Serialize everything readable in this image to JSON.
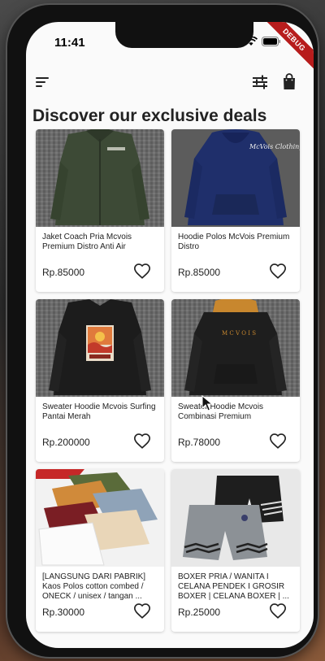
{
  "status_bar": {
    "time": "11:41"
  },
  "debug_banner": "DEBUG",
  "appbar": {
    "menu_icon": "menu-icon",
    "filter_icon": "tune-icon",
    "cart_icon": "shopping-bag-icon"
  },
  "page_title": "Discover our exclusive deals",
  "products": [
    {
      "name": "Jaket Coach Pria Mcvois Premium Distro Anti Air",
      "price": "Rp.85000",
      "image": "olive-coach-jacket"
    },
    {
      "name": "Hoodie Polos McVois Premium Distro",
      "price": "Rp.85000",
      "image": "navy-hoodie"
    },
    {
      "name": "Sweater Hoodie Mcvois Surfing Pantai Merah",
      "price": "Rp.200000",
      "image": "black-hoodie-surf-print"
    },
    {
      "name": "Sweater Hoodie Mcvois Combinasi Premium",
      "price": "Rp.78000",
      "image": "black-hoodie-orange-hood"
    },
    {
      "name": "[LANGSUNG DARI PABRIK] Kaos Polos cotton combed / ONECK / unisex / tangan ...",
      "price": "Rp.30000",
      "image": "folded-tshirts"
    },
    {
      "name": "BOXER PRIA / WANITA I CELANA PENDEK I GROSIR BOXER | CELANA BOXER | ...",
      "price": "Rp.25000",
      "image": "boxer-shorts"
    }
  ],
  "colors": {
    "accent_ribbon": "#b71c1c",
    "background": "#fafafa"
  }
}
